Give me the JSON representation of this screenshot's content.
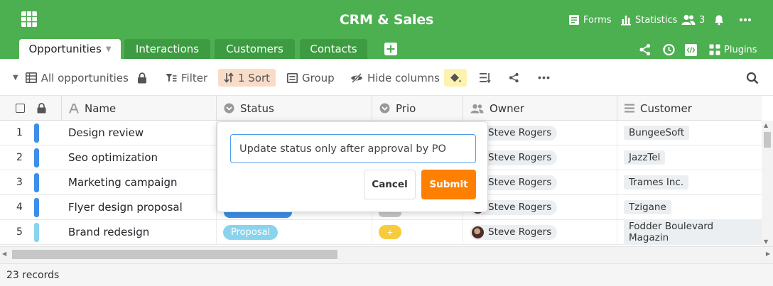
{
  "app": {
    "title": "CRM & Sales"
  },
  "header_actions": {
    "forms_label": "Forms",
    "statistics_label": "Statistics",
    "collaborators_count": "3",
    "plugins_label": "Plugins"
  },
  "tabs": [
    {
      "label": "Opportunities",
      "active": true
    },
    {
      "label": "Interactions",
      "active": false
    },
    {
      "label": "Customers",
      "active": false
    },
    {
      "label": "Contacts",
      "active": false
    }
  ],
  "toolbar": {
    "view_label": "All opportunities",
    "filter_label": "Filter",
    "sort_label": "1 Sort",
    "group_label": "Group",
    "hide_columns_label": "Hide columns"
  },
  "columns": [
    {
      "label": "Name",
      "icon": "text-icon"
    },
    {
      "label": "Status",
      "icon": "single-select-icon"
    },
    {
      "label": "Prio",
      "icon": "single-select-icon"
    },
    {
      "label": "Owner",
      "icon": "collaborator-icon"
    },
    {
      "label": "Customer",
      "icon": "link-icon"
    }
  ],
  "rows": [
    {
      "num": "1",
      "name": "Design review",
      "owner": "Steve Rogers",
      "customer": "BungeeSoft",
      "color": "#3b8eea"
    },
    {
      "num": "2",
      "name": "Seo optimization",
      "owner": "Steve Rogers",
      "customer": "JazzTel",
      "color": "#3b8eea"
    },
    {
      "num": "3",
      "name": "Marketing campaign",
      "owner": "Steve Rogers",
      "customer": "Trames Inc.",
      "color": "#3b8eea"
    },
    {
      "num": "4",
      "name": "Flyer design proposal",
      "owner": "Steve Rogers",
      "customer": "Tzigane",
      "color": "#3b8eea"
    },
    {
      "num": "5",
      "name": "Brand redesign",
      "status": "Proposal",
      "prio": "+",
      "owner": "Steve Rogers",
      "customer": "Fodder Boulevard Magazin",
      "color": "#8ad3ec"
    }
  ],
  "footer": {
    "records": "23 records"
  },
  "popover": {
    "input_value": "Update status only after approval by PO",
    "cancel_label": "Cancel",
    "submit_label": "Submit"
  },
  "colors": {
    "header_green": "#4caf50",
    "submit_orange": "#ff8000",
    "sort_highlight": "#f9dcc8",
    "paint_highlight": "#fdf3b0",
    "status_proposal": "#8ad3ec",
    "prio_yellow": "#f7cc3c"
  }
}
